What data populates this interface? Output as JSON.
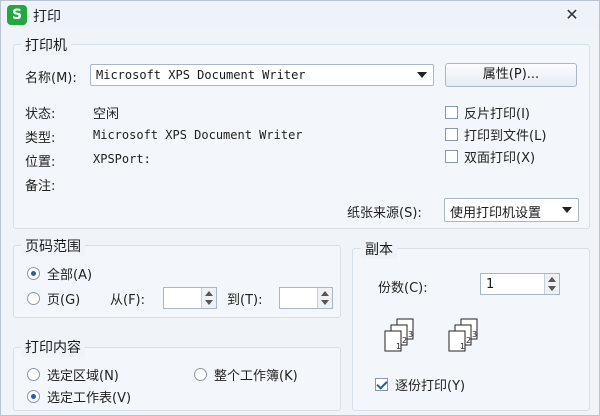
{
  "window": {
    "title": "打印",
    "app_icon": "S",
    "close": "✕"
  },
  "printer": {
    "group_title": "打印机",
    "name_label": "名称(M):",
    "name_value": "Microsoft XPS Document Writer",
    "properties_button": "属性(P)...",
    "status_label": "状态:",
    "status_value": "空闲",
    "type_label": "类型:",
    "type_value": "Microsoft XPS Document Writer",
    "location_label": "位置:",
    "location_value": "XPSPort:",
    "comment_label": "备注:",
    "reverse_print": "反片打印(I)",
    "print_to_file": "打印到文件(L)",
    "duplex": "双面打印(X)",
    "paper_source_label": "纸张来源(S):",
    "paper_source_value": "使用打印机设置"
  },
  "page_range": {
    "group_title": "页码范围",
    "all": "全部(A)",
    "pages": "页(G)",
    "from_label": "从(F):",
    "from_value": "",
    "to_label": "到(T):",
    "to_value": ""
  },
  "copies": {
    "group_title": "副本",
    "count_label": "份数(C):",
    "count_value": "1",
    "collate": "逐份打印(Y)",
    "collate_checked": true
  },
  "print_what": {
    "group_title": "打印内容",
    "selection": "选定区域(N)",
    "whole_workbook": "整个工作簿(K)",
    "active_sheets": "选定工作表(V)"
  }
}
